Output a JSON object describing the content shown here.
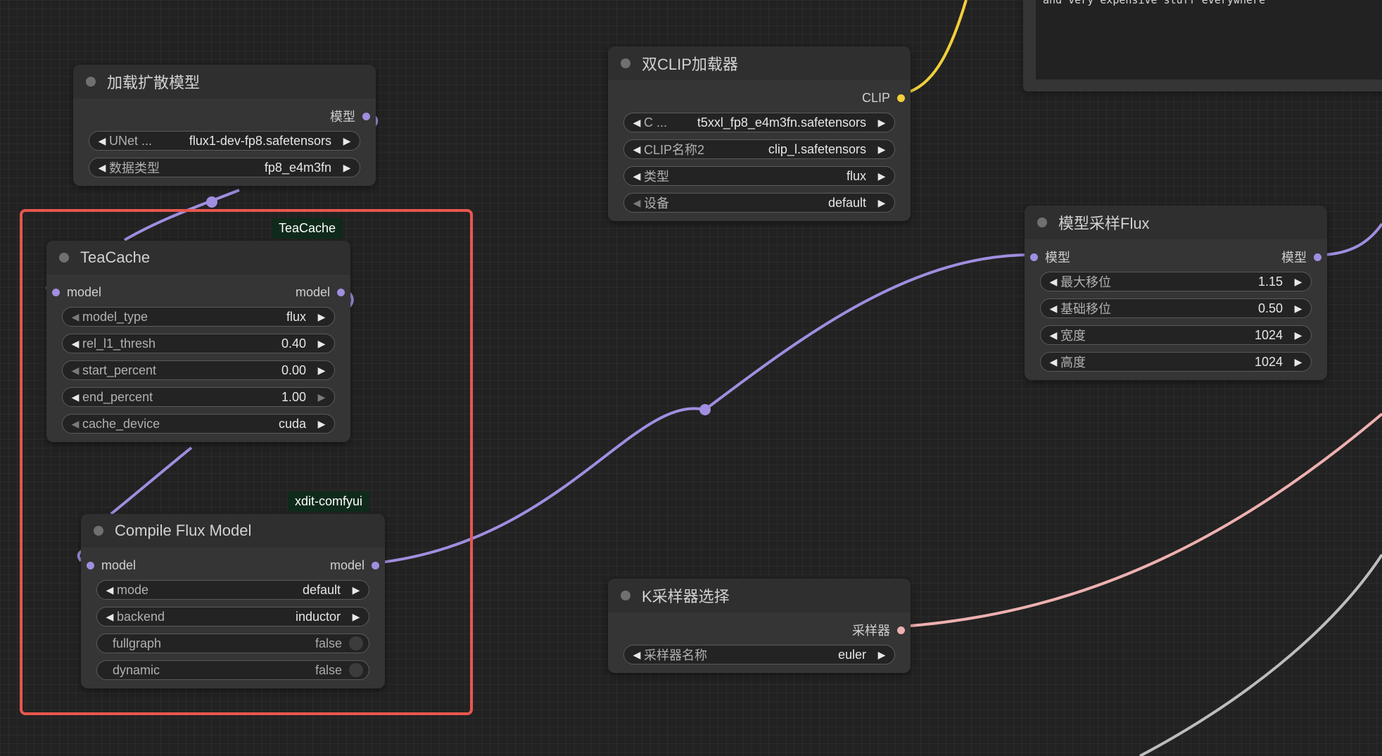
{
  "colors": {
    "model_wire": "#a08ee0",
    "clip_wire": "#f2d03b",
    "sampler_wire": "#eeb0b0",
    "grey_wire": "#bdbdbd",
    "selection": "#e8564e",
    "badge_bg": "#0f2a1a"
  },
  "note": {
    "text": "and very expensive stuff everywhere"
  },
  "badges": {
    "teacache": "TeaCache",
    "xdit": "xdit-comfyui"
  },
  "nodes": {
    "load_diffusion": {
      "title": "加载扩散模型",
      "output": "模型",
      "widgets": [
        {
          "label": "UNet ...",
          "value": "flux1-dev-fp8.safetensors"
        },
        {
          "label": "数据类型",
          "value": "fp8_e4m3fn"
        }
      ]
    },
    "dual_clip": {
      "title": "双CLIP加载器",
      "output": "CLIP",
      "widgets": [
        {
          "label": "C ...",
          "value": "t5xxl_fp8_e4m3fn.safetensors"
        },
        {
          "label": "CLIP名称2",
          "value": "clip_l.safetensors"
        },
        {
          "label": "类型",
          "value": "flux"
        },
        {
          "label": "设备",
          "value": "default"
        }
      ]
    },
    "teacache": {
      "title": "TeaCache",
      "input": "model",
      "output": "model",
      "widgets": [
        {
          "label": "model_type",
          "value": "flux"
        },
        {
          "label": "rel_l1_thresh",
          "value": "0.40"
        },
        {
          "label": "start_percent",
          "value": "0.00"
        },
        {
          "label": "end_percent",
          "value": "1.00"
        },
        {
          "label": "cache_device",
          "value": "cuda"
        }
      ]
    },
    "compile_flux": {
      "title": "Compile Flux Model",
      "input": "model",
      "output": "model",
      "widgets": [
        {
          "label": "mode",
          "value": "default"
        },
        {
          "label": "backend",
          "value": "inductor"
        },
        {
          "label": "fullgraph",
          "value": "false"
        },
        {
          "label": "dynamic",
          "value": "false"
        }
      ]
    },
    "model_sampling_flux": {
      "title": "模型采样Flux",
      "input": "模型",
      "output": "模型",
      "widgets": [
        {
          "label": "最大移位",
          "value": "1.15"
        },
        {
          "label": "基础移位",
          "value": "0.50"
        },
        {
          "label": "宽度",
          "value": "1024"
        },
        {
          "label": "高度",
          "value": "1024"
        }
      ]
    },
    "ksampler_select": {
      "title": "K采样器选择",
      "output": "采样器",
      "widgets": [
        {
          "label": "采样器名称",
          "value": "euler"
        }
      ]
    }
  }
}
